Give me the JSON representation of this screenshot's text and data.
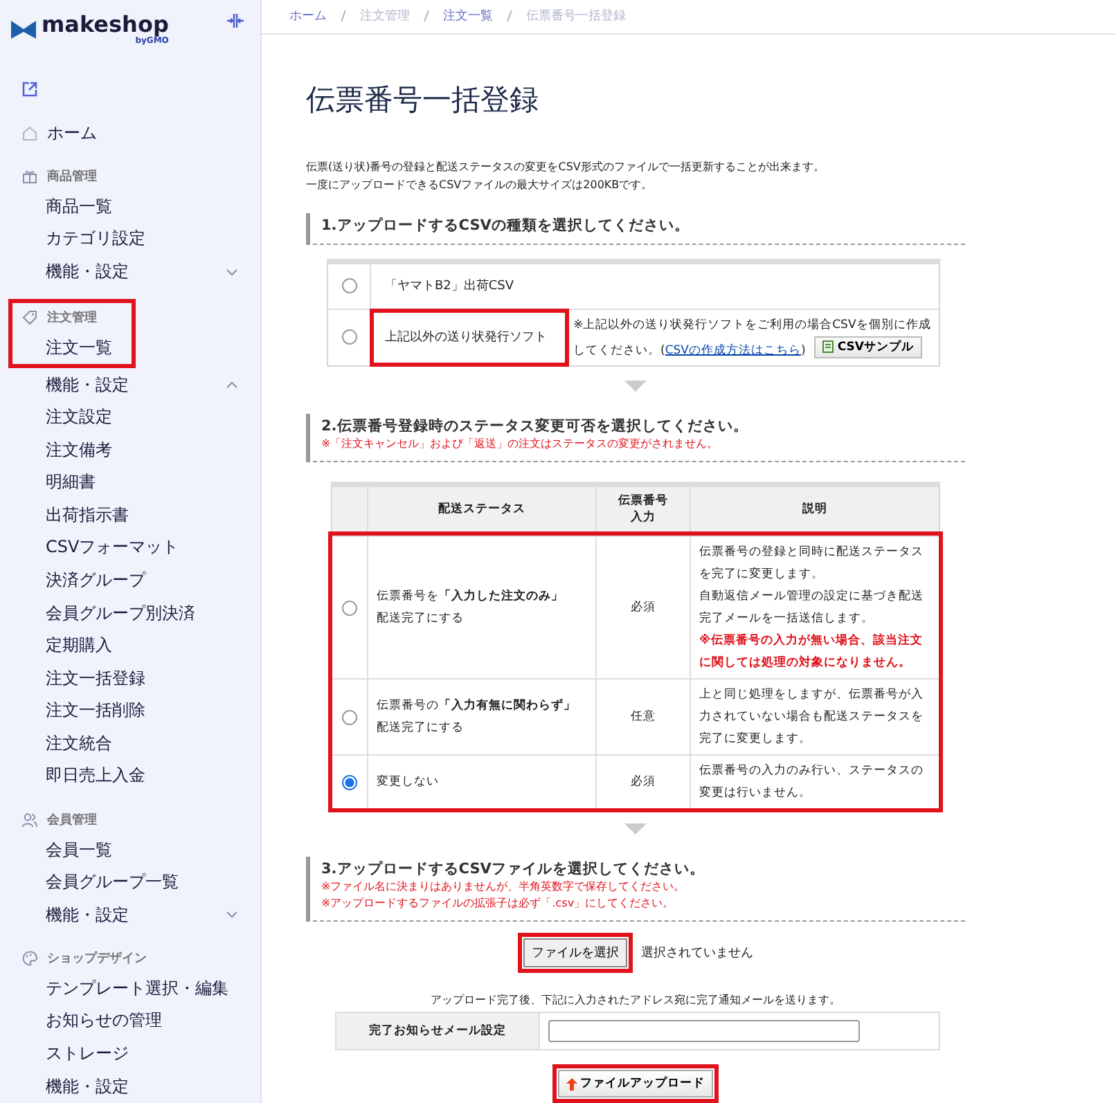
{
  "sidebar": {
    "logo": {
      "name": "makeshop",
      "sub": "byGMO"
    },
    "top_items": [
      {
        "label": "ホーム"
      }
    ],
    "sections": [
      {
        "title": "商品管理",
        "highlighted": false,
        "items": [
          {
            "kind": "link",
            "label": "商品一覧"
          },
          {
            "kind": "link",
            "label": "カテゴリ設定"
          },
          {
            "kind": "toggle",
            "label": "機能・設定",
            "expanded": false
          }
        ]
      },
      {
        "title": "注文管理",
        "highlighted": true,
        "items": [
          {
            "kind": "link",
            "label": "注文一覧"
          },
          {
            "kind": "toggle",
            "label": "機能・設定",
            "expanded": true
          },
          {
            "kind": "link",
            "label": "注文設定"
          },
          {
            "kind": "link",
            "label": "注文備考"
          },
          {
            "kind": "link",
            "label": "明細書"
          },
          {
            "kind": "link",
            "label": "出荷指示書"
          },
          {
            "kind": "link",
            "label": "CSVフォーマット"
          },
          {
            "kind": "link",
            "label": "決済グループ"
          },
          {
            "kind": "link",
            "label": "会員グループ別決済"
          },
          {
            "kind": "link",
            "label": "定期購入"
          },
          {
            "kind": "link",
            "label": "注文一括登録"
          },
          {
            "kind": "link",
            "label": "注文一括削除"
          },
          {
            "kind": "link",
            "label": "注文統合"
          },
          {
            "kind": "link",
            "label": "即日売上入金"
          }
        ]
      },
      {
        "title": "会員管理",
        "highlighted": false,
        "items": [
          {
            "kind": "link",
            "label": "会員一覧"
          },
          {
            "kind": "link",
            "label": "会員グループ一覧"
          },
          {
            "kind": "toggle",
            "label": "機能・設定",
            "expanded": false
          }
        ]
      },
      {
        "title": "ショップデザイン",
        "highlighted": false,
        "items": [
          {
            "kind": "link",
            "label": "テンプレート選択・編集"
          },
          {
            "kind": "link",
            "label": "お知らせの管理"
          },
          {
            "kind": "link",
            "label": "ストレージ"
          },
          {
            "kind": "link",
            "label": "機能・設定"
          }
        ]
      }
    ]
  },
  "breadcrumb": [
    {
      "label": "ホーム",
      "link": true
    },
    {
      "label": "注文管理",
      "link": false
    },
    {
      "label": "注文一覧",
      "link": true
    },
    {
      "label": "伝票番号一括登録",
      "link": false
    }
  ],
  "title": "伝票番号一括登録",
  "intro": [
    "伝票(送り状)番号の登録と配送ステータスの変更をCSV形式のファイルで一括更新することが出来ます。",
    "一度にアップロードできるCSVファイルの最大サイズは200KBです。"
  ],
  "step1": {
    "heading": "1.アップロードするCSVの種類を選択してください。",
    "options": [
      {
        "label": "「ヤマトB2」出荷CSV",
        "selected": false,
        "highlighted": false
      },
      {
        "label": "上記以外の送り状発行ソフト",
        "selected": false,
        "highlighted": true,
        "note_before": "※上記以外の送り状発行ソフトをご利用の場合CSVを個別に作成してください。(",
        "link": "CSVの作成方法はこちら",
        "note_after": ")",
        "sample_button": "CSVサンプル"
      }
    ]
  },
  "step2": {
    "heading": "2.伝票番号登録時のステータス変更可否を選択してください。",
    "warning": "※「注文キャンセル」および「返送」の注文はステータスの変更がされません。",
    "highlighted": true,
    "columns": [
      "配送ステータス",
      "伝票番号入力",
      "説明"
    ],
    "rows": [
      {
        "selected": false,
        "status": [
          "伝票番号を**「入力した注文のみ」**",
          "配送完了にする"
        ],
        "input": "必須",
        "description": [
          "伝票番号の登録と同時に配送ステータスを完了に変更します。",
          "自動返信メール管理の設定に基づき配送完了メールを一括送信します。"
        ],
        "warning": "※伝票番号の入力が無い場合、該当注文に関しては処理の対象になりません。"
      },
      {
        "selected": false,
        "status": [
          "伝票番号の**「入力有無に関わらず」**",
          "配送完了にする"
        ],
        "input": "任意",
        "description": [
          "上と同じ処理をしますが、伝票番号が入力されていない場合も配送ステータスを完了に変更します。"
        ]
      },
      {
        "selected": true,
        "status": [
          "変更しない"
        ],
        "input": "必須",
        "description": [
          "伝票番号の入力のみ行い、ステータスの変更は行いません。"
        ]
      }
    ]
  },
  "step3": {
    "heading": "3.アップロードするCSVファイルを選択してください。",
    "notes": [
      "※ファイル名に決まりはありませんが、半角英数字で保存してください。",
      "※アップロードするファイルの拡張子は必ず「.csv」にしてください。"
    ],
    "file_button": {
      "label": "ファイルを選択",
      "highlighted": true
    },
    "file_status": "選択されていません",
    "mail_note": "アップロード完了後、下記に入力されたアドレス宛に完了通知メールを送ります。",
    "mail_label": "完了お知らせメール設定",
    "upload_button": {
      "label": "ファイルアップロード",
      "highlighted": true
    }
  }
}
